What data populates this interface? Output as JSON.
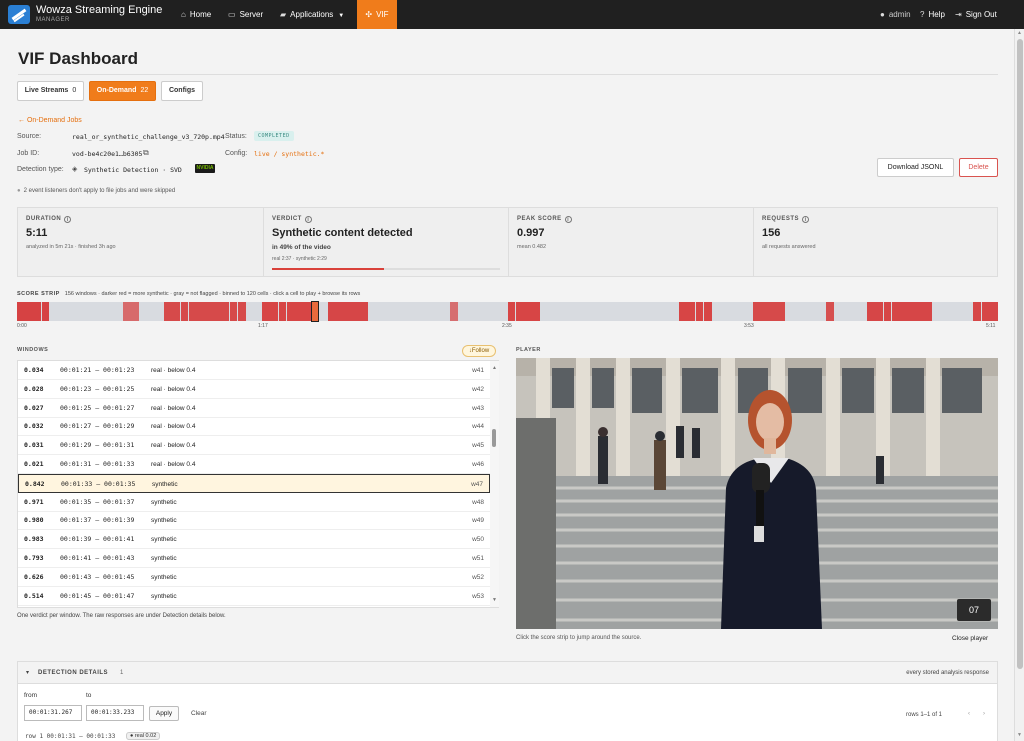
{
  "nav": {
    "brand": "Wowza Streaming Engine",
    "brand_sub": "MANAGER",
    "home": "Home",
    "server": "Server",
    "applications": "Applications",
    "vif": "VIF",
    "user": "admin",
    "help": "Help",
    "signout": "Sign Out",
    "icons": [
      "home-icon",
      "monitor-icon",
      "folder-icon",
      "vif-icon",
      "user-icon",
      "help-icon",
      "sign-out-icon"
    ]
  },
  "page": {
    "title": "VIF Dashboard",
    "tabs": [
      {
        "label": "Live Streams",
        "count": "0"
      },
      {
        "label": "On-Demand",
        "count": "22"
      },
      {
        "label": "Configs",
        "count": ""
      }
    ],
    "back_link": "← On-Demand Jobs"
  },
  "job": {
    "source_label": "Source:",
    "source": "real_or_synthetic_challenge_v3_720p.mp4",
    "status_label": "Status:",
    "status": "COMPLETED",
    "id_label": "Job ID:",
    "id": "vod-be4c20e1…b6305",
    "config_label": "Config:",
    "config": "live / synthetic.*",
    "detection_label": "Detection type:",
    "detection": "Synthetic Detection · SVD",
    "vendor": "NVIDIA",
    "download": "Download JSONL",
    "delete": "Delete",
    "notice": "2 event listeners don't apply to file jobs and were skipped"
  },
  "stats": {
    "duration": {
      "label": "DURATION",
      "value": "5:11",
      "sub": "analyzed in 5m 21s · finished 3h ago"
    },
    "verdict": {
      "label": "VERDICT",
      "value": "Synthetic content detected",
      "sub": "in 49% of the video",
      "split": "real 2:37 · synthetic 2:29",
      "fraction": 0.49
    },
    "peak": {
      "label": "PEAK SCORE",
      "value": "0.997",
      "sub": "mean 0.482"
    },
    "requests": {
      "label": "REQUESTS",
      "value": "156",
      "sub": "all requests answered"
    }
  },
  "strip": {
    "label": "SCORE STRIP",
    "caption": "156 windows · darker red = more synthetic · gray = not flagged · binned to 120 cells · click a cell to play + browse its rows",
    "cells": 120,
    "flagged": [
      [
        0,
        4,
        0.92
      ],
      [
        13,
        15,
        0.55
      ],
      [
        18,
        28,
        0.85
      ],
      [
        30,
        36,
        0.9
      ],
      [
        38,
        43,
        0.88
      ],
      [
        53,
        54,
        0.5
      ],
      [
        60,
        64,
        0.9
      ],
      [
        81,
        85,
        0.9
      ],
      [
        90,
        94,
        0.85
      ],
      [
        99,
        100,
        0.8
      ],
      [
        104,
        112,
        0.88
      ],
      [
        117,
        120,
        0.88
      ]
    ],
    "cursor_cell": 36,
    "ticks": [
      "0:00",
      "1:17",
      "2:35",
      "3:53",
      "5:11"
    ]
  },
  "windows": {
    "label": "WINDOWS",
    "follow": "↓Follow",
    "rows": [
      {
        "score": "0.034",
        "time": "00:01:21 – 00:01:23",
        "verdict": "real · below 0.4",
        "id": "w41"
      },
      {
        "score": "0.028",
        "time": "00:01:23 – 00:01:25",
        "verdict": "real · below 0.4",
        "id": "w42"
      },
      {
        "score": "0.027",
        "time": "00:01:25 – 00:01:27",
        "verdict": "real · below 0.4",
        "id": "w43"
      },
      {
        "score": "0.032",
        "time": "00:01:27 – 00:01:29",
        "verdict": "real · below 0.4",
        "id": "w44"
      },
      {
        "score": "0.031",
        "time": "00:01:29 – 00:01:31",
        "verdict": "real · below 0.4",
        "id": "w45"
      },
      {
        "score": "0.021",
        "time": "00:01:31 – 00:01:33",
        "verdict": "real · below 0.4",
        "id": "w46"
      },
      {
        "score": "0.842",
        "time": "00:01:33 – 00:01:35",
        "verdict": "synthetic",
        "id": "w47"
      },
      {
        "score": "0.971",
        "time": "00:01:35 – 00:01:37",
        "verdict": "synthetic",
        "id": "w48"
      },
      {
        "score": "0.980",
        "time": "00:01:37 – 00:01:39",
        "verdict": "synthetic",
        "id": "w49"
      },
      {
        "score": "0.983",
        "time": "00:01:39 – 00:01:41",
        "verdict": "synthetic",
        "id": "w50"
      },
      {
        "score": "0.793",
        "time": "00:01:41 – 00:01:43",
        "verdict": "synthetic",
        "id": "w51"
      },
      {
        "score": "0.626",
        "time": "00:01:43 – 00:01:45",
        "verdict": "synthetic",
        "id": "w52"
      },
      {
        "score": "0.514",
        "time": "00:01:45 – 00:01:47",
        "verdict": "synthetic",
        "id": "w53"
      }
    ],
    "selected_index": 6,
    "note": "One verdict per window. The raw responses are under Detection details below."
  },
  "player": {
    "label": "PLAYER",
    "frame": "07",
    "note": "Click the score strip to jump around the source.",
    "close": "Close player"
  },
  "details": {
    "title": "DETECTION DETAILS",
    "count": "1",
    "right": "every stored analysis response",
    "from_label": "from",
    "to_label": "to",
    "from": "00:01:31.267",
    "to": "00:01:33.233",
    "apply": "Apply",
    "clear": "Clear",
    "rows_info": "rows 1–1 of 1",
    "prev": "‹",
    "next": "›",
    "row1": "row 1  00:01:31 – 00:01:33",
    "row1_badge": "● real 0.02"
  },
  "colors": {
    "accent": "#f07c1b",
    "danger": "#d9534f",
    "flag": "#d9413a",
    "unflagged": "#d8dbe0"
  }
}
